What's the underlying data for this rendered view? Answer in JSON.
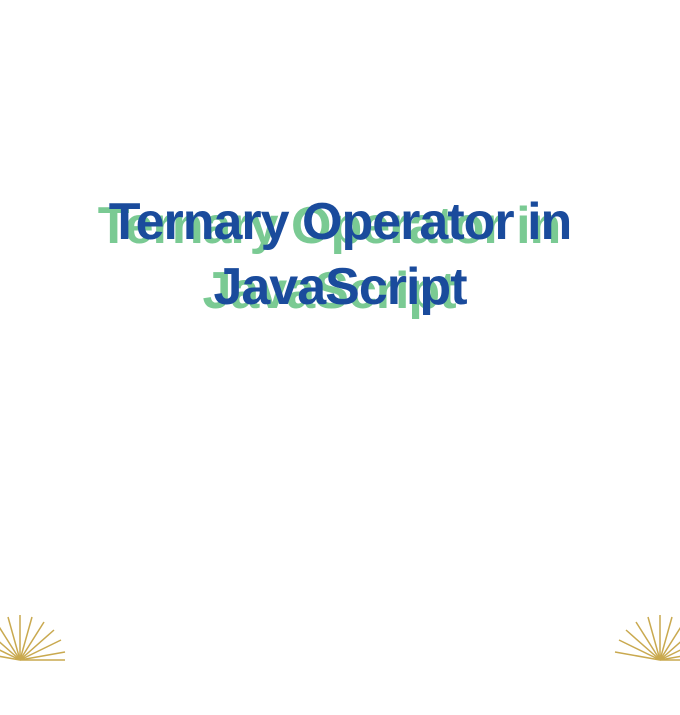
{
  "heading": {
    "line1": "Ternary Operator in",
    "line2": "JavaScript"
  },
  "colors": {
    "title_main": "#1a4b9c",
    "title_shadow": "#7aca93",
    "burst_stroke": "#c9a94f",
    "background": "#ffffff"
  }
}
